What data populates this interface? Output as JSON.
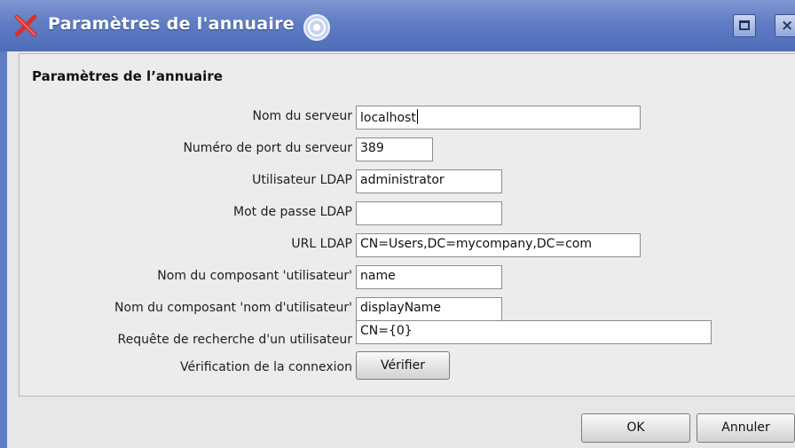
{
  "window": {
    "title": "Paramètres de l'annuaire",
    "icons": [
      "app-x-icon",
      "shade-icon",
      "maximize-icon",
      "close-icon"
    ]
  },
  "group": {
    "title": "Paramètres de l’annuaire"
  },
  "fields": {
    "server_name": {
      "label": "Nom du serveur",
      "value": "localhost"
    },
    "server_port": {
      "label": "Numéro de port du serveur",
      "value": "389"
    },
    "ldap_user": {
      "label": "Utilisateur LDAP",
      "value": "administrator"
    },
    "ldap_password": {
      "label": "Mot de passe LDAP",
      "value": ""
    },
    "ldap_url": {
      "label": "URL LDAP",
      "value": "CN=Users,DC=mycompany,DC=com"
    },
    "user_component": {
      "label": "Nom du composant 'utilisateur'",
      "value": "name"
    },
    "username_component": {
      "label": "Nom du composant 'nom d'utilisateur'",
      "value": "displayName"
    },
    "user_search_query": {
      "label": "Requête de recherche d'un utilisateur",
      "value": "CN={0}"
    },
    "connection_check": {
      "label": "Vérification de la connexion",
      "button": "Vérifier"
    }
  },
  "footer": {
    "ok": "OK",
    "cancel": "Annuler"
  },
  "colors": {
    "titlebar": "#5f7cc4",
    "app_icon": "#d9312b",
    "dialog_bg": "#e7e7e7"
  }
}
